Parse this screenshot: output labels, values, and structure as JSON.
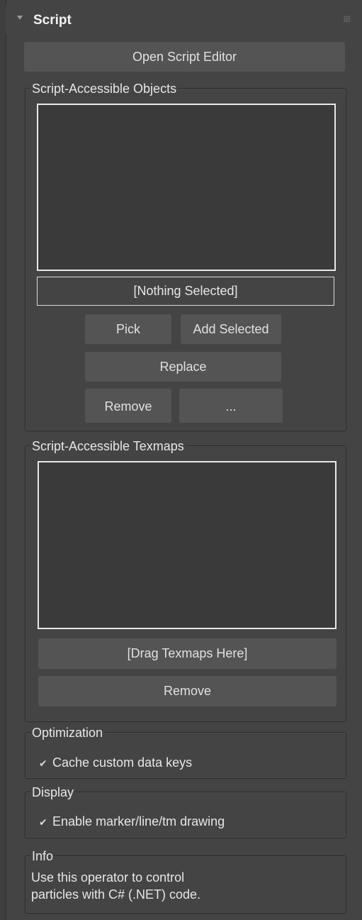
{
  "rollout": {
    "title": "Script",
    "open_editor_label": "Open Script Editor"
  },
  "objects_group": {
    "label": "Script-Accessible Objects",
    "selection_value": "[Nothing Selected]",
    "pick_label": "Pick",
    "add_selected_label": "Add Selected",
    "replace_label": "Replace",
    "remove_label": "Remove",
    "more_label": "..."
  },
  "texmaps_group": {
    "label": "Script-Accessible Texmaps",
    "drag_label": "[Drag Texmaps Here]",
    "remove_label": "Remove"
  },
  "optimization_group": {
    "label": "Optimization",
    "cache_checked": true,
    "cache_label": "Cache custom data keys"
  },
  "display_group": {
    "label": "Display",
    "drawing_checked": true,
    "drawing_label": "Enable marker/line/tm drawing"
  },
  "info_group": {
    "label": "Info",
    "line1": "Use this operator to control",
    "line2": "particles with C# (.NET) code."
  }
}
